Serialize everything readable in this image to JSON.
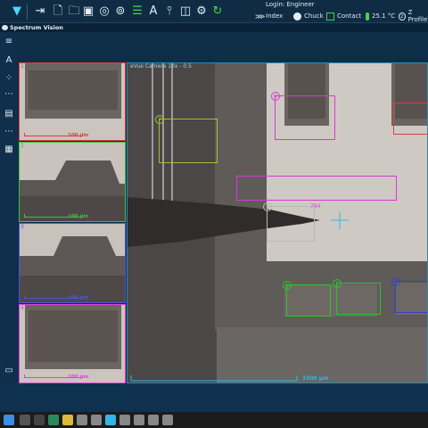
{
  "app": {
    "title": "Spectrum Vision"
  },
  "toolbar": {
    "login_label": "Login: Engineer",
    "status": {
      "index": "Index",
      "chuck": "Chuck",
      "contact": "Contact",
      "temperature": "25.1 °C",
      "z_profile": "Z Profile"
    }
  },
  "camera": {
    "title": "eVue Camera 10x - 0.5",
    "scalebar": "1000 µm"
  },
  "thumbnails": [
    {
      "number": "1",
      "scalebar": "100 µm",
      "color": "#d64040"
    },
    {
      "number": "2",
      "scalebar": "100 µm",
      "color": "#3ec23e"
    },
    {
      "number": "3",
      "scalebar": "100 µm",
      "color": "#4c55d8"
    },
    {
      "number": "4",
      "scalebar": "100 µm",
      "color": "#e040e0"
    }
  ],
  "rois": [
    {
      "number": "6",
      "color": "#d43ad4"
    },
    {
      "number": "7",
      "color": "#9cc23c"
    },
    {
      "number": "1",
      "color": "#b8b8b8",
      "label": "784"
    },
    {
      "number": "6",
      "color": "#2ec22e"
    },
    {
      "number": "2",
      "color": "#2ec22e"
    },
    {
      "number": "3",
      "color": "#3a3ad6"
    }
  ],
  "colors": {
    "accent": "#33b5e5",
    "toolbar_bg": "#0f2c44",
    "crosshair": "#33b5e5"
  }
}
